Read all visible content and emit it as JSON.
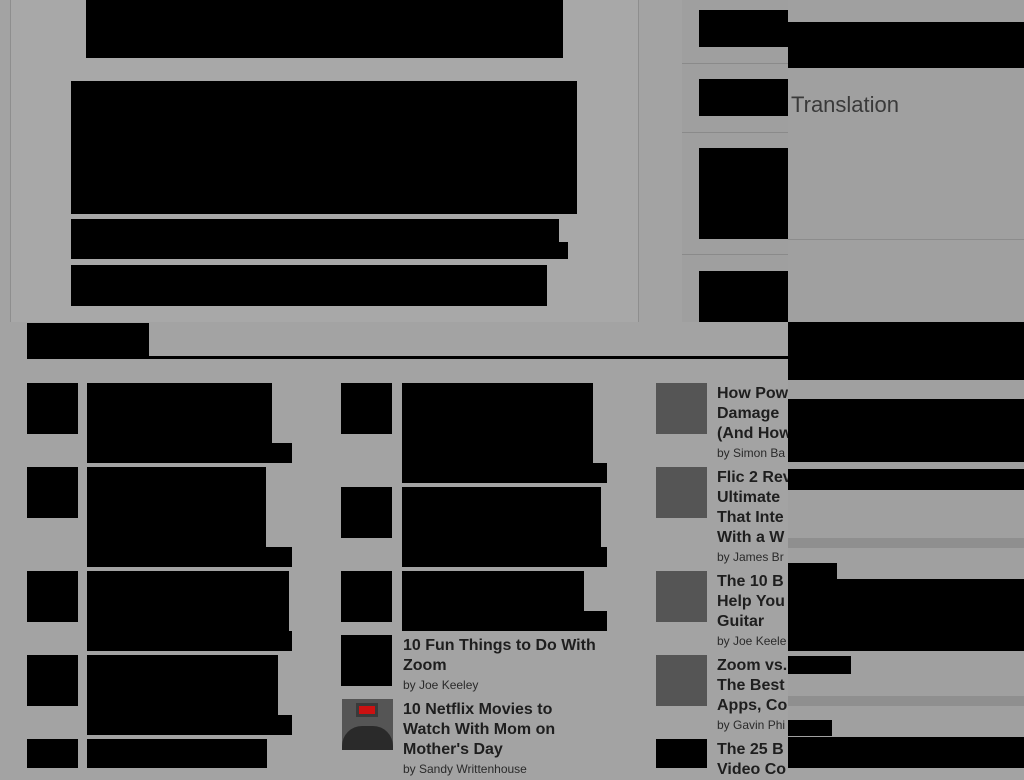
{
  "overlay": {
    "translation_label": "Translation"
  },
  "column2": {
    "items": [
      {
        "title_line1": "10 Fun Things to Do With",
        "title_line2": "Zoom",
        "byline": "by Joe Keeley"
      },
      {
        "title_line1": "10 Netflix Movies to",
        "title_line2": "Watch With Mom on",
        "title_line3": "Mother's Day",
        "byline": "by Sandy Writtenhouse"
      }
    ]
  },
  "column3": {
    "items": [
      {
        "title_line1": "How Pow",
        "title_line2": "Damage",
        "title_line3": "(And How",
        "byline": "by Simon Ba",
        "thumb_icon": "skull-thumb"
      },
      {
        "title_line1": "Flic 2 Rev",
        "title_line2": "Ultimate",
        "title_line3": "That Inte",
        "title_line4": "With a W",
        "byline": "by James Br",
        "thumb_icon": "button-thumb"
      },
      {
        "title_line1": "The 10 B",
        "title_line2": "Help You",
        "title_line3": "Guitar",
        "byline": "by Joe Keele",
        "thumb_icon": "guitar-thumb"
      },
      {
        "title_line1": "Zoom vs.",
        "title_line2": "The Best",
        "title_line3": "Apps, Co",
        "byline": "by Gavin Phi",
        "thumb_icon": "desk-thumb"
      },
      {
        "title_line1": "The 25 B",
        "title_line2": "Video Co"
      }
    ]
  },
  "colors": {
    "page_background": "#a3a3a3",
    "redaction": "#000000",
    "overlay_panel": "#a0a0a0"
  }
}
